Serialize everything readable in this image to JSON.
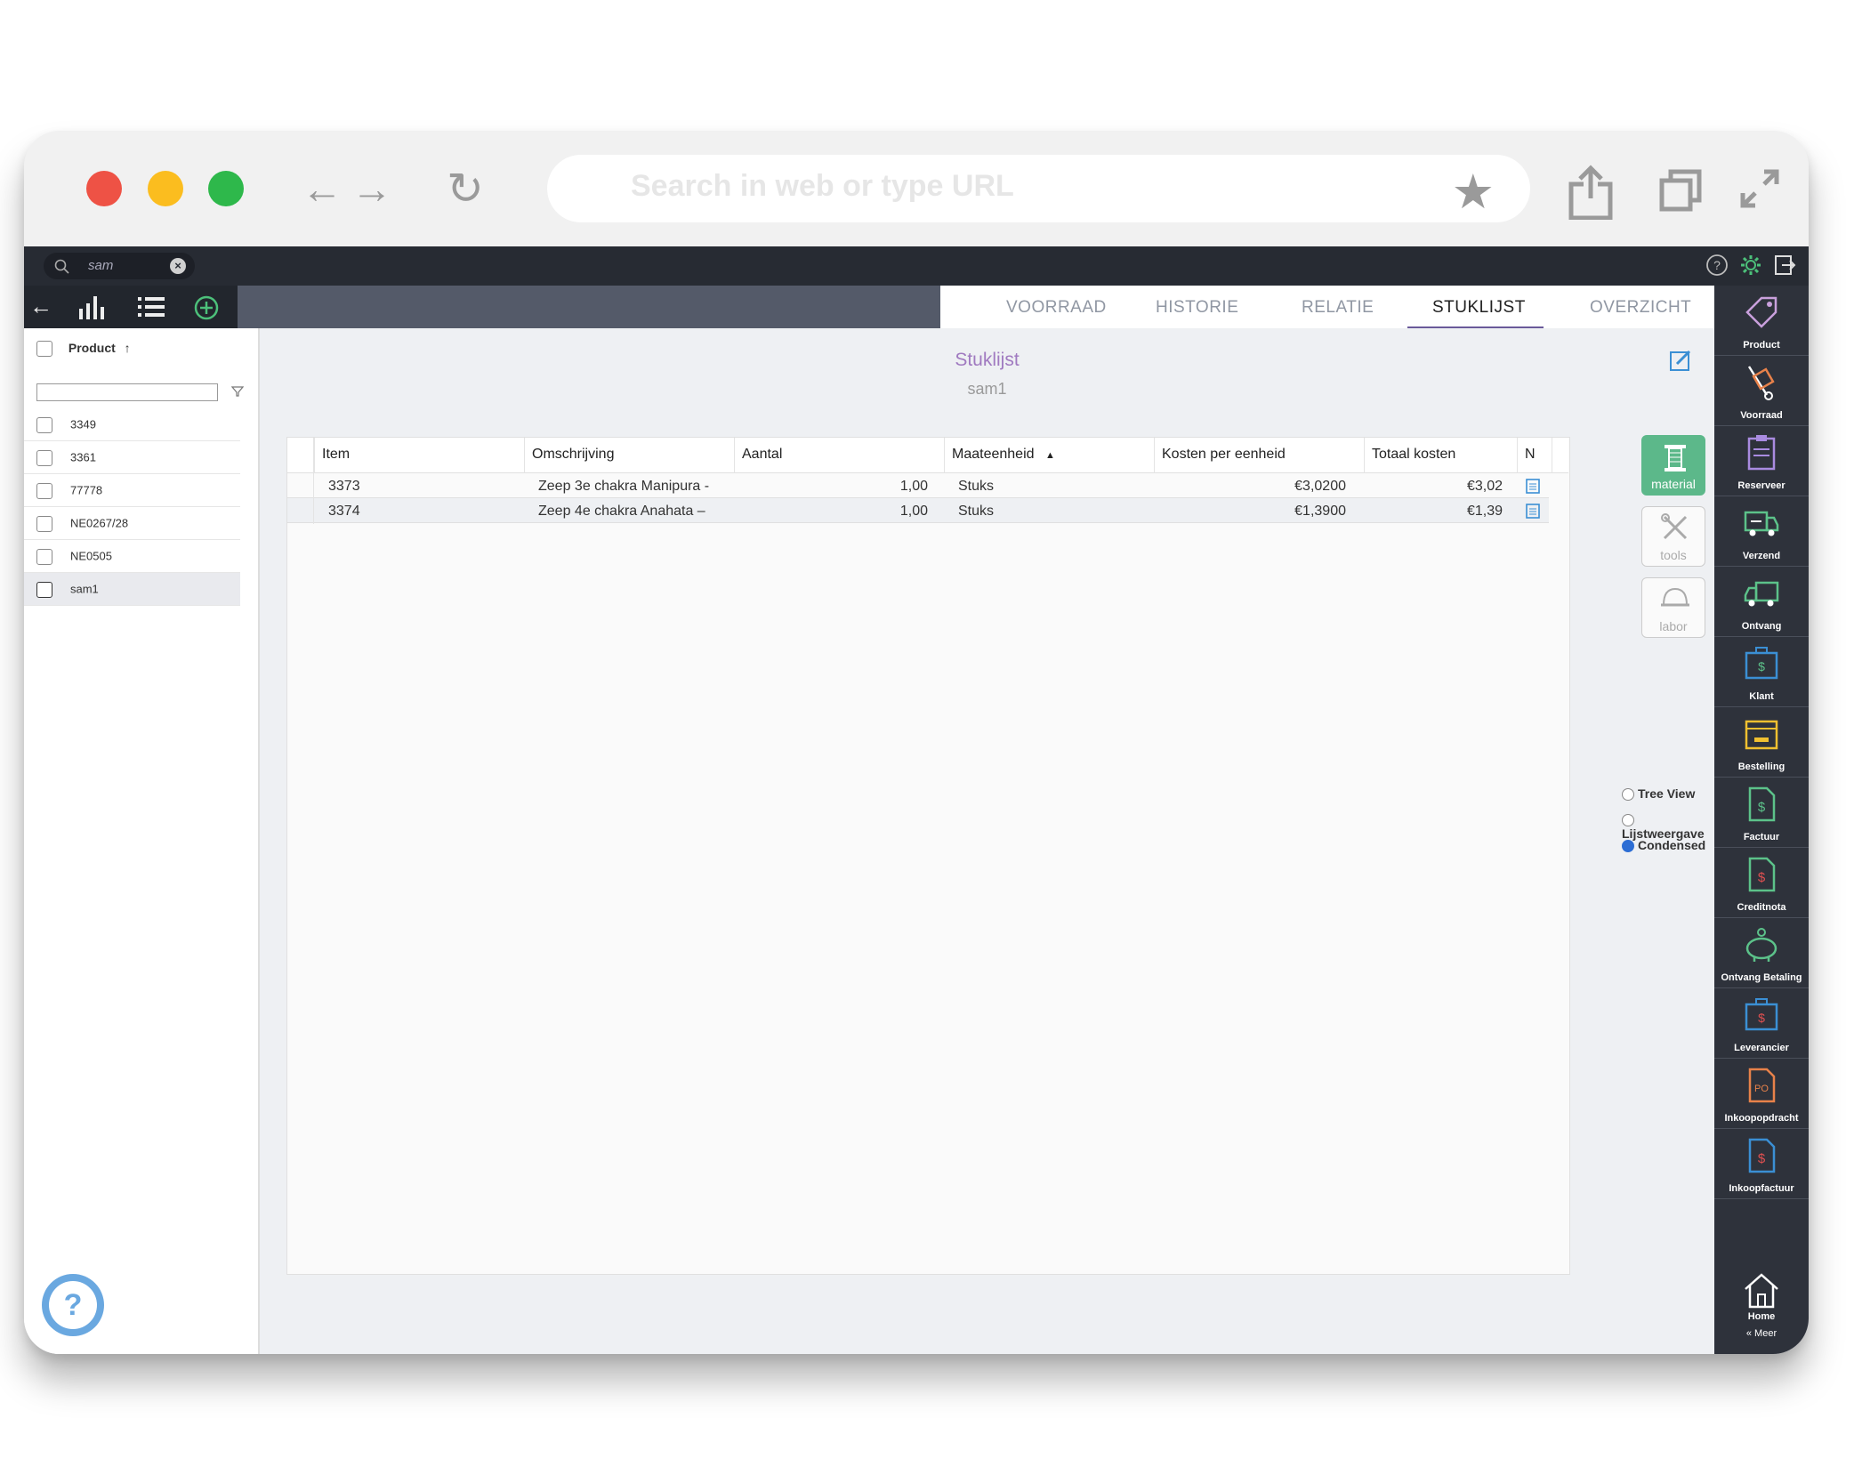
{
  "browser": {
    "url_placeholder": "Search in web or type URL"
  },
  "topbar": {
    "search_value": "sam"
  },
  "tabs": [
    {
      "label": "VOORRAAD"
    },
    {
      "label": "HISTORIE"
    },
    {
      "label": "RELATIE"
    },
    {
      "label": "STUKLIJST"
    },
    {
      "label": "OVERZICHT"
    }
  ],
  "left_panel": {
    "header": "Product",
    "sort_indicator": "↑",
    "rows": [
      "3349",
      "3361",
      "77778",
      "NE0267/28",
      "NE0505",
      "sam1"
    ]
  },
  "main": {
    "title": "Stuklijst",
    "subtitle": "sam1",
    "columns": [
      "Item",
      "Omschrijving",
      "Aantal",
      "Maateenheid",
      "Kosten per eenheid",
      "Totaal kosten",
      "N"
    ],
    "rows": [
      {
        "item": "3373",
        "omschrijving": "Zeep 3e chakra Manipura -",
        "aantal": "1,00",
        "maateenheid": "Stuks",
        "kosten": "€3,0200",
        "totaal": "€3,02"
      },
      {
        "item": "3374",
        "omschrijving": "Zeep 4e chakra Anahata –",
        "aantal": "1,00",
        "maateenheid": "Stuks",
        "kosten": "€1,3900",
        "totaal": "€1,39"
      }
    ]
  },
  "side_buttons": [
    {
      "label": "material",
      "active": true
    },
    {
      "label": "tools",
      "active": false
    },
    {
      "label": "labor",
      "active": false
    }
  ],
  "view_options": [
    {
      "label": "Tree View",
      "selected": false
    },
    {
      "label": "Lijstweergave",
      "selected": false
    },
    {
      "label": "Condensed",
      "selected": true
    }
  ],
  "right_nav": [
    {
      "label": "Product",
      "icon": "tag-icon",
      "color": "#c9a0dc"
    },
    {
      "label": "Voorraad",
      "icon": "hand-truck-icon",
      "color": "#e8824a"
    },
    {
      "label": "Reserveer",
      "icon": "clipboard-icon",
      "color": "#a98be0"
    },
    {
      "label": "Verzend",
      "icon": "truck-out-icon",
      "color": "#5cc28a"
    },
    {
      "label": "Ontvang",
      "icon": "truck-in-icon",
      "color": "#5cc28a"
    },
    {
      "label": "Klant",
      "icon": "briefcase-dollar-icon",
      "color": "#3b8fd4"
    },
    {
      "label": "Bestelling",
      "icon": "box-icon",
      "color": "#f0c030"
    },
    {
      "label": "Factuur",
      "icon": "invoice-icon",
      "color": "#5cc28a"
    },
    {
      "label": "Creditnota",
      "icon": "credit-note-icon",
      "color": "#5cc28a"
    },
    {
      "label": "Ontvang Betaling",
      "icon": "piggy-bank-icon",
      "color": "#5cc28a"
    },
    {
      "label": "Leverancier",
      "icon": "briefcase-supplier-icon",
      "color": "#3b8fd4"
    },
    {
      "label": "Inkoopopdracht",
      "icon": "purchase-order-icon",
      "color": "#e8824a"
    },
    {
      "label": "Inkoopfactuur",
      "icon": "purchase-invoice-icon",
      "color": "#3b8fd4"
    },
    {
      "label": "Home",
      "icon": "home-icon",
      "color": "#ffffff"
    }
  ],
  "more_label": "« Meer"
}
